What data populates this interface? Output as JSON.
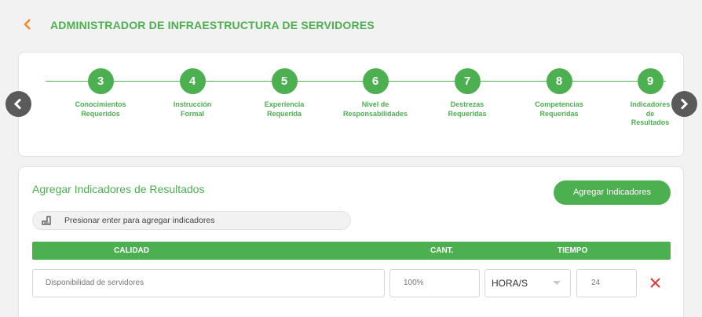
{
  "header": {
    "back_icon": "chevron-left-icon",
    "title": "ADMINISTRADOR DE INFRAESTRUCTURA DE SERVIDORES",
    "accent_color": "#f08a24"
  },
  "stepper": {
    "color": "#4caf50",
    "steps": [
      {
        "number": "3",
        "label": "Conocimientos\nRequeridos"
      },
      {
        "number": "4",
        "label": "Instrucción\nFormal"
      },
      {
        "number": "5",
        "label": "Experiencia\nRequerida"
      },
      {
        "number": "6",
        "label": "Nivel de\nResponsabilidades"
      },
      {
        "number": "7",
        "label": "Destrezas\nRequeridas"
      },
      {
        "number": "8",
        "label": "Competencias\nRequeridas"
      },
      {
        "number": "9",
        "label": "Indicadores\nde\nResultados"
      }
    ],
    "prev_icon": "chevron-left-icon",
    "next_icon": "chevron-right-icon"
  },
  "form": {
    "title": "Agregar Indicadores de Resultados",
    "add_button": "Agregar Indicadores",
    "hint_icon": "enter-key-icon",
    "hint": "Presionar enter para agregar indicadores",
    "columns": {
      "calidad": "CALIDAD",
      "cant": "CANT.",
      "tiempo": "TIEMPO"
    },
    "row": {
      "calidad": "Disponibilidad de servidores",
      "cant": "100%",
      "unit": "HORA/S",
      "tiempo": "24",
      "delete_icon": "close-icon",
      "delete_color": "#e53935"
    }
  }
}
